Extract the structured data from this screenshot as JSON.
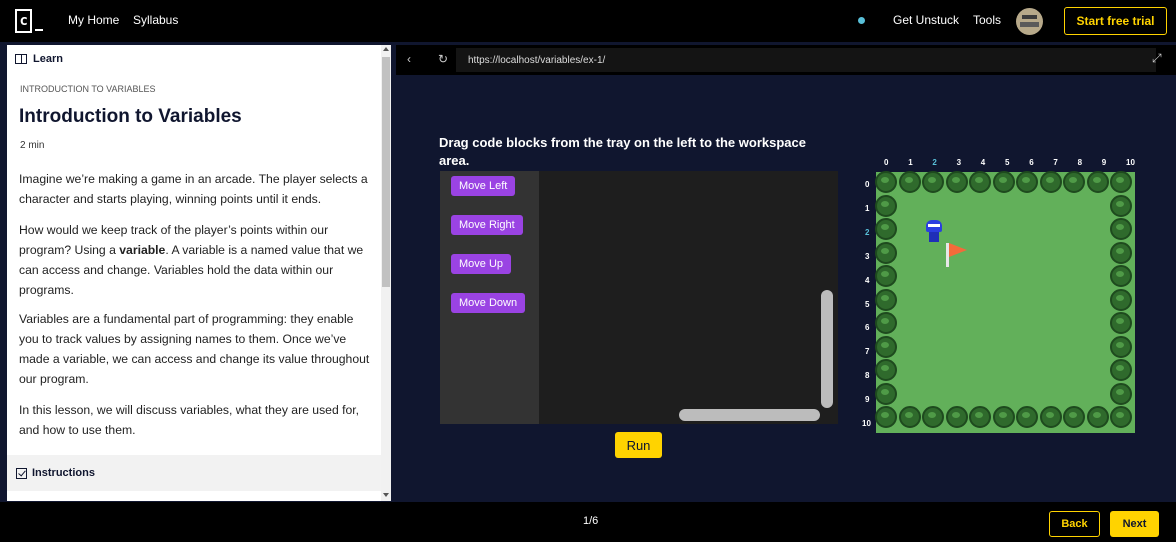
{
  "topnav": {
    "logo_text": "c",
    "my_home": "My Home",
    "syllabus": "Syllabus",
    "get_unstuck": "Get Unstuck",
    "tools": "Tools",
    "trial_button": "Start free trial"
  },
  "lesson": {
    "panel_label": "Learn",
    "kicker": "INTRODUCTION TO VARIABLES",
    "title": "Introduction to Variables",
    "duration": "2 min",
    "p1": "Imagine we’re making a game in an arcade. The player selects a character and starts playing, winning points until it ends.",
    "p2_pre": "How would we keep track of the player’s points within our program? Using a ",
    "p2_bold": "variable",
    "p2_post": ". A variable is a named value that we can access and change. Variables hold the data within our programs.",
    "p3": "Variables are a fundamental part of programming: they enable you to track values by assigning names to them. Once we’ve made a variable, we can access and change its value throughout our program.",
    "p4": "In this lesson, we will discuss variables, what they are used for, and how to use them.",
    "instructions_label": "Instructions"
  },
  "browser": {
    "url": "https://localhost/variables/ex-1/"
  },
  "exercise": {
    "instruction": "Drag code blocks from the tray on the left to the workspace area.",
    "blocks": [
      "Move Left",
      "Move Right",
      "Move Up",
      "Move Down"
    ],
    "run_label": "Run",
    "grid_cols": [
      "0",
      "1",
      "2",
      "3",
      "4",
      "5",
      "6",
      "7",
      "8",
      "9",
      "10"
    ],
    "grid_rows": [
      "0",
      "1",
      "2",
      "3",
      "4",
      "5",
      "6",
      "7",
      "8",
      "9",
      "10"
    ],
    "robot_cell": {
      "col": 2,
      "row": 2
    },
    "flag_cell": {
      "col": 3,
      "row": 3
    }
  },
  "bottom": {
    "progress": "1/6",
    "back_label": "Back",
    "next_label": "Next"
  },
  "colors": {
    "accent": "#ffd300",
    "block": "#9a43e3",
    "grass": "#62b05a",
    "background": "#10162f"
  }
}
